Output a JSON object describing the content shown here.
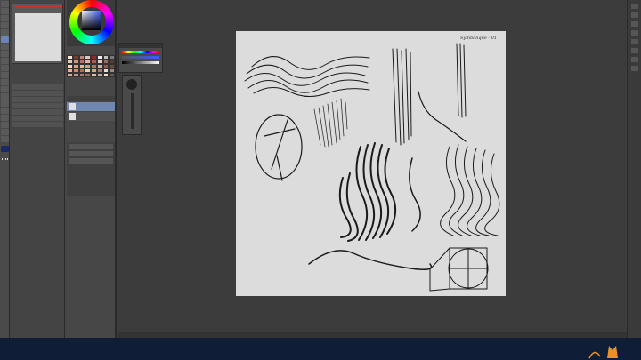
{
  "canvas_note": "Symbolique - 01",
  "colors": {
    "ui_bg": "#3c3c3c",
    "canvas_bg": "#dcdcdc",
    "taskbar": "#0f1d36",
    "accent_selected": "#7088b0",
    "logo_orange": "#e8922a"
  },
  "palette_colors": [
    "#f3e6da",
    "#7a3a2c",
    "#b88776",
    "#d8c8c0",
    "#8e2d1f",
    "#f0f0f0",
    "#c0c0c0",
    "#7a7a7a",
    "#e8c8b8",
    "#c89a86",
    "#b0736a",
    "#d9b7a0",
    "#a55c4b",
    "#e0cfc4",
    "#9c6a5a",
    "#5a3a30",
    "#f5d5c0",
    "#d0a090",
    "#e6b59c",
    "#c9a28f",
    "#a8745f",
    "#c4b0a6",
    "#8c5c4c",
    "#6b4a3f",
    "#e8b598",
    "#cc8a70",
    "#b86a50",
    "#f0d0b8",
    "#d5a58a",
    "#a87860",
    "#e8e0d8",
    "#9a8a80",
    "#d6a890",
    "#c49080",
    "#b07a68",
    "#9a6a58",
    "#dbbba8",
    "#c8a898",
    "#f0e0d0",
    "#6a5a50"
  ]
}
